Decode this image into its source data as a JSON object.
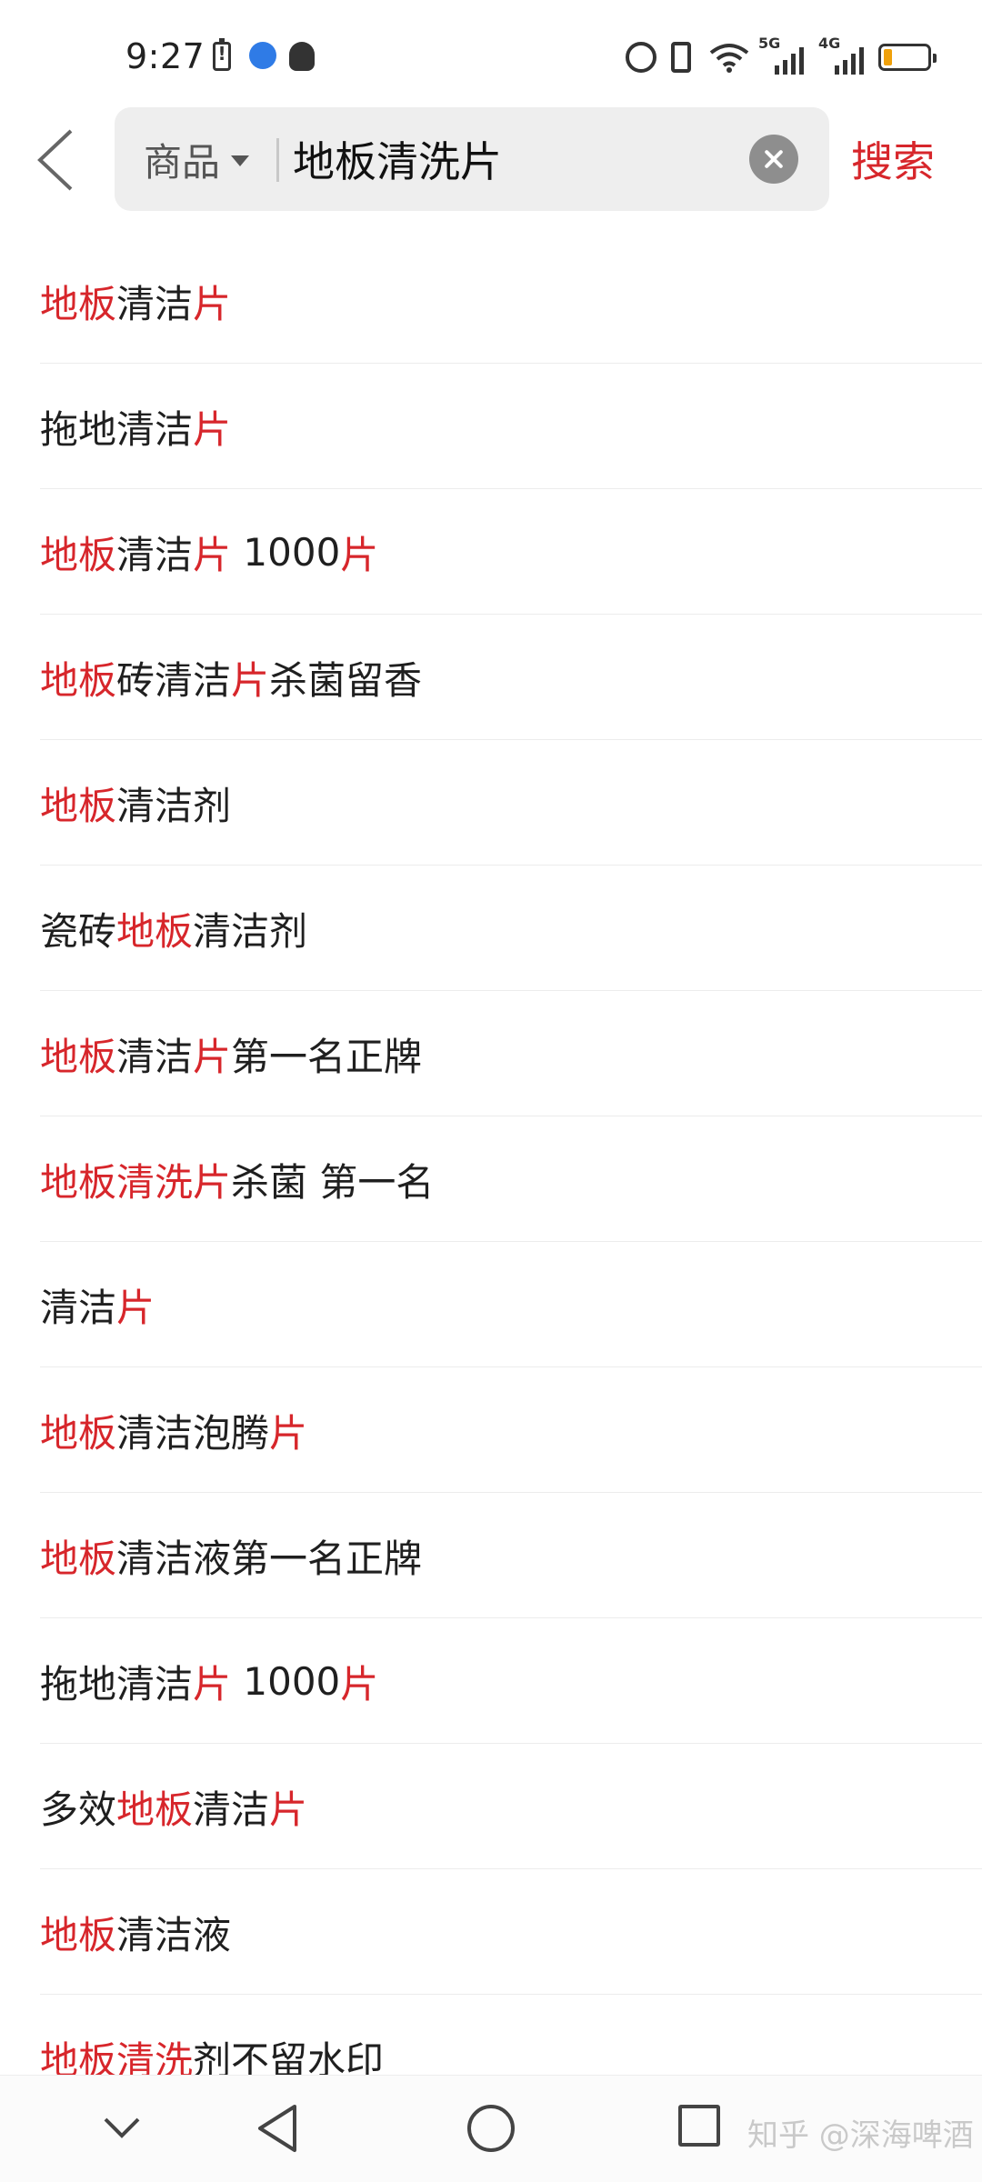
{
  "status_bar": {
    "time": "9:27",
    "icons": [
      "battery-alert-icon",
      "app-notification-icon",
      "qq-icon",
      "alarm-icon",
      "vibrate-icon",
      "wifi-icon",
      "signal-5g-icon",
      "signal-4g-icon",
      "battery-icon"
    ],
    "network_1": "5G",
    "network_2": "4G",
    "battery_level": 0.2
  },
  "search": {
    "scope_label": "商品",
    "query": "地板清洗片",
    "button_label": "搜索"
  },
  "colors": {
    "accent": "#d7262b",
    "text": "#1f1f1f",
    "search_box_bg": "#eeeeee"
  },
  "suggestions": [
    {
      "segments": [
        {
          "t": "地板",
          "h": true
        },
        {
          "t": "清洁",
          "h": false
        },
        {
          "t": "片",
          "h": true
        }
      ]
    },
    {
      "segments": [
        {
          "t": "拖地清洁",
          "h": false
        },
        {
          "t": "片",
          "h": true
        }
      ]
    },
    {
      "segments": [
        {
          "t": "地板",
          "h": true
        },
        {
          "t": "清洁",
          "h": false
        },
        {
          "t": "片",
          "h": true
        },
        {
          "t": " 1000",
          "h": false
        },
        {
          "t": "片",
          "h": true
        }
      ]
    },
    {
      "segments": [
        {
          "t": "地板",
          "h": true
        },
        {
          "t": "砖清洁",
          "h": false
        },
        {
          "t": "片",
          "h": true
        },
        {
          "t": "杀菌留香",
          "h": false
        }
      ]
    },
    {
      "segments": [
        {
          "t": "地板",
          "h": true
        },
        {
          "t": "清洁剂",
          "h": false
        }
      ]
    },
    {
      "segments": [
        {
          "t": "瓷砖",
          "h": false
        },
        {
          "t": "地板",
          "h": true
        },
        {
          "t": "清洁剂",
          "h": false
        }
      ]
    },
    {
      "segments": [
        {
          "t": "地板",
          "h": true
        },
        {
          "t": "清洁",
          "h": false
        },
        {
          "t": "片",
          "h": true
        },
        {
          "t": "第一名正牌",
          "h": false
        }
      ]
    },
    {
      "segments": [
        {
          "t": "地板清洗片",
          "h": true
        },
        {
          "t": "杀菌 第一名",
          "h": false
        }
      ]
    },
    {
      "segments": [
        {
          "t": "清洁",
          "h": false
        },
        {
          "t": "片",
          "h": true
        }
      ]
    },
    {
      "segments": [
        {
          "t": "地板",
          "h": true
        },
        {
          "t": "清洁泡腾",
          "h": false
        },
        {
          "t": "片",
          "h": true
        }
      ]
    },
    {
      "segments": [
        {
          "t": "地板",
          "h": true
        },
        {
          "t": "清洁液第一名正牌",
          "h": false
        }
      ]
    },
    {
      "segments": [
        {
          "t": "拖地清洁",
          "h": false
        },
        {
          "t": "片",
          "h": true
        },
        {
          "t": " 1000",
          "h": false
        },
        {
          "t": "片",
          "h": true
        }
      ]
    },
    {
      "segments": [
        {
          "t": "多效",
          "h": false
        },
        {
          "t": "地板",
          "h": true
        },
        {
          "t": "清洁",
          "h": false
        },
        {
          "t": "片",
          "h": true
        }
      ]
    },
    {
      "segments": [
        {
          "t": "地板",
          "h": true
        },
        {
          "t": "清洁液",
          "h": false
        }
      ]
    },
    {
      "segments": [
        {
          "t": "地板清洗",
          "h": true
        },
        {
          "t": "剂不留水印",
          "h": false
        }
      ]
    }
  ],
  "nav_bar": {
    "icons": [
      "collapse-icon",
      "back-triangle-icon",
      "home-circle-icon",
      "recents-square-icon"
    ],
    "watermark": "知乎 @深海啤酒"
  }
}
